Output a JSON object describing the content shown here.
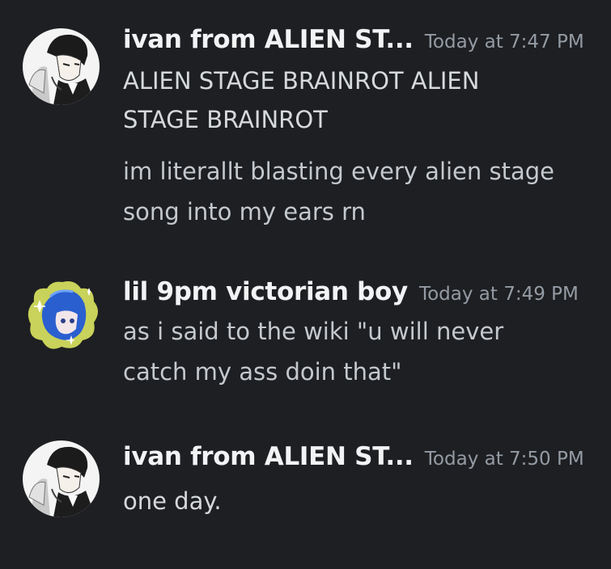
{
  "messages": [
    {
      "username": "ivan from ALIEN ST...",
      "timestamp": "Today at 7:47 PM",
      "avatar_icon": "anime-boy-avatar-icon",
      "lines": [
        "ALIEN STAGE BRAINROT ALIEN",
        "STAGE BRAINROT",
        "im literallt blasting every alien stage",
        "song into my ears rn"
      ]
    },
    {
      "username": "lil 9pm victorian boy",
      "timestamp": "Today at 7:49 PM",
      "avatar_icon": "blue-hair-avatar-icon",
      "lines": [
        "as i said to the wiki \"u will never",
        "catch my ass doin that\""
      ]
    },
    {
      "username": "ivan from ALIEN ST...",
      "timestamp": "Today at 7:50 PM",
      "avatar_icon": "anime-boy-avatar-icon",
      "lines": [
        "one day."
      ]
    }
  ],
  "colors": {
    "background": "#1e1f22",
    "username": "#f2f3f5",
    "timestamp": "#949ba4",
    "message_text": "#c4c9ce"
  }
}
